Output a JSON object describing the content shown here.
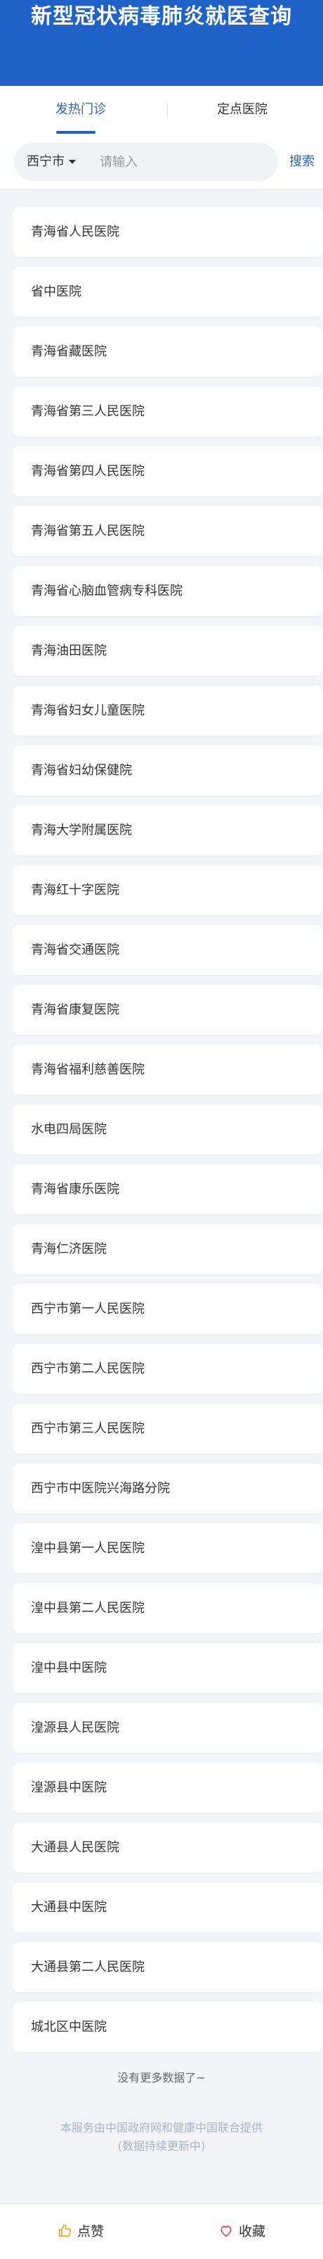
{
  "header": {
    "title": "新型冠状病毒肺炎就医查询"
  },
  "tabs": [
    {
      "label": "发热门诊",
      "active": true
    },
    {
      "label": "定点医院",
      "active": false
    }
  ],
  "search": {
    "city": "西宁市",
    "placeholder": "请输入",
    "button_label": "搜索"
  },
  "hospitals": [
    "青海省人民医院",
    "省中医院",
    "青海省藏医院",
    "青海省第三人民医院",
    "青海省第四人民医院",
    "青海省第五人民医院",
    "青海省心脑血管病专科医院",
    "青海油田医院",
    "青海省妇女儿童医院",
    "青海省妇幼保健院",
    "青海大学附属医院",
    "青海红十字医院",
    "青海省交通医院",
    "青海省康复医院",
    "青海省福利慈善医院",
    "水电四局医院",
    "青海省康乐医院",
    "青海仁济医院",
    "西宁市第一人民医院",
    "西宁市第二人民医院",
    "西宁市第三人民医院",
    "西宁市中医院兴海路分院",
    "湟中县第一人民医院",
    "湟中县第二人民医院",
    "湟中县中医院",
    "湟源县人民医院",
    "湟源县中医院",
    "大通县人民医院",
    "大通县中医院",
    "大通县第二人民医院",
    "城北区中医院"
  ],
  "status": {
    "no_more": "没有更多数据了~"
  },
  "footer": {
    "line1": "本服务由中国政府网和健康中国联合提供",
    "line2": "(数据持续更新中)"
  },
  "bottom_bar": {
    "like_label": "点赞",
    "favorite_label": "收藏",
    "like_icon": "thumbs-up-icon",
    "favorite_icon": "heart-icon"
  },
  "colors": {
    "primary": "#1e62c8",
    "like_icon": "#f0a020",
    "favorite_icon": "#e8424e"
  }
}
